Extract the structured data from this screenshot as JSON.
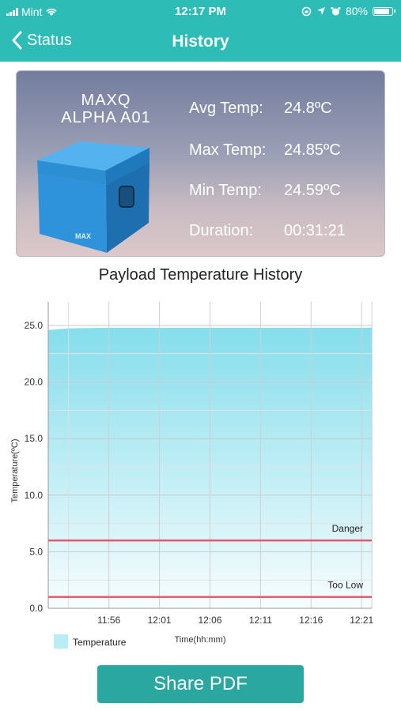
{
  "status_bar": {
    "carrier": "Mint",
    "time": "12:17 PM",
    "battery": "80%"
  },
  "nav": {
    "back_label": "Status",
    "title": "History"
  },
  "summary": {
    "device_line1": "MAXQ",
    "device_line2": "ALPHA A01",
    "box_logo": "MAX",
    "stats": [
      {
        "label": "Avg Temp:",
        "value": "24.8ºC"
      },
      {
        "label": "Max Temp:",
        "value": "24.85ºC"
      },
      {
        "label": "Min Temp:",
        "value": "24.59ºC"
      },
      {
        "label": "Duration:",
        "value": "00:31:21"
      }
    ]
  },
  "chart_title": "Payload Temperature History",
  "chart_data": {
    "type": "area",
    "title": "Payload Temperature History",
    "xlabel": "Time(hh:mm)",
    "ylabel": "Temperature(ºC)",
    "ylim": [
      0,
      25
    ],
    "yticks": [
      "0.0",
      "5.0",
      "10.0",
      "15.0",
      "20.0",
      "25.0"
    ],
    "xticks": [
      "11:56",
      "12:01",
      "12:06",
      "12:11",
      "12:16",
      "12:21"
    ],
    "x": [
      "11:50",
      "11:52",
      "11:56",
      "12:01",
      "12:06",
      "12:11",
      "12:16",
      "12:21",
      "12:22"
    ],
    "series": [
      {
        "name": "Temperature",
        "values": [
          24.6,
          24.75,
          24.8,
          24.8,
          24.8,
          24.8,
          24.8,
          24.8,
          24.8
        ]
      }
    ],
    "thresholds": [
      {
        "label": "Danger",
        "value": 6.0,
        "color": "#e05a6a"
      },
      {
        "label": "Too Low",
        "value": 1.0,
        "color": "#e05a6a"
      }
    ],
    "grid": true,
    "legend": "bottom-left",
    "area_color": "#7fdceb"
  },
  "share_label": "Share PDF"
}
